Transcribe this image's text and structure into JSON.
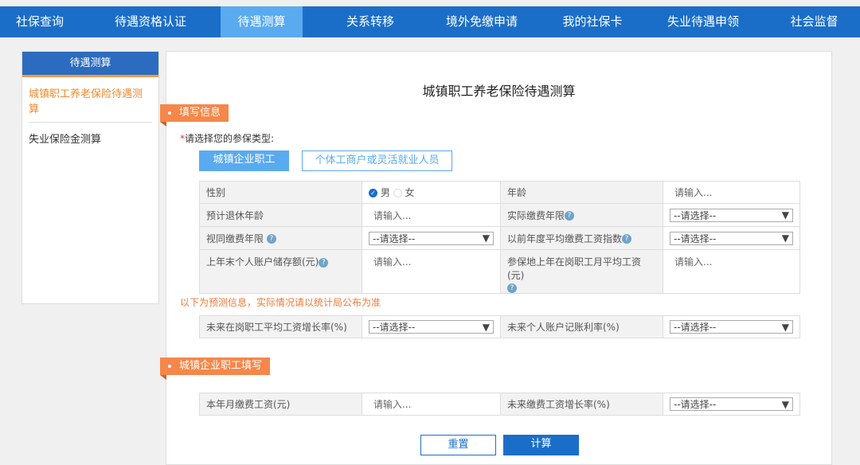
{
  "nav": {
    "tabs": [
      "社保查询",
      "待遇资格认证",
      "待遇测算",
      "关系转移",
      "境外免缴申请",
      "我的社保卡",
      "失业待遇申领",
      "社会监督"
    ],
    "active": 2
  },
  "sidebar": {
    "header": "待遇测算",
    "items": [
      "城镇职工养老保险待遇测算",
      "失业保险金测算"
    ]
  },
  "main": {
    "title": "城镇职工养老保险待遇测算",
    "section1": "填写信息",
    "required_mark": "*",
    "type_prompt": "请选择您的参保类型:",
    "type_buttons": [
      "城镇企业职工",
      "个体工商户或灵活就业人员"
    ],
    "fields": {
      "gender": "性别",
      "male": "男",
      "female": "女",
      "age": "年龄",
      "retire_age": "预计退休年龄",
      "actual_years": "实际缴费年限",
      "deemed_years": "视同缴费年限",
      "avg_index": "以前年度平均缴费工资指数",
      "balance": "上年末个人账户储存额(元)",
      "avg_wage": "参保地上年在岗职工月平均工资(元)",
      "wage_growth": "未来在岗职工平均工资增长率(%)",
      "interest_rate": "未来个人账户记账利率(%)",
      "month_wage": "本年月缴费工资(元)",
      "pay_growth": "未来缴费工资增长率(%)"
    },
    "input_placeholder": "请输入...",
    "select_placeholder": "--请选择--",
    "help": "?",
    "notice": "以下为预测信息，实际情况请以统计局公布为准",
    "section2": "城镇企业职工填写",
    "reset": "重置",
    "calc": "计算"
  },
  "colors": {
    "nav": "#1b6ec8",
    "active_tab": "#5aaaf0",
    "accent": "#f5874a"
  }
}
